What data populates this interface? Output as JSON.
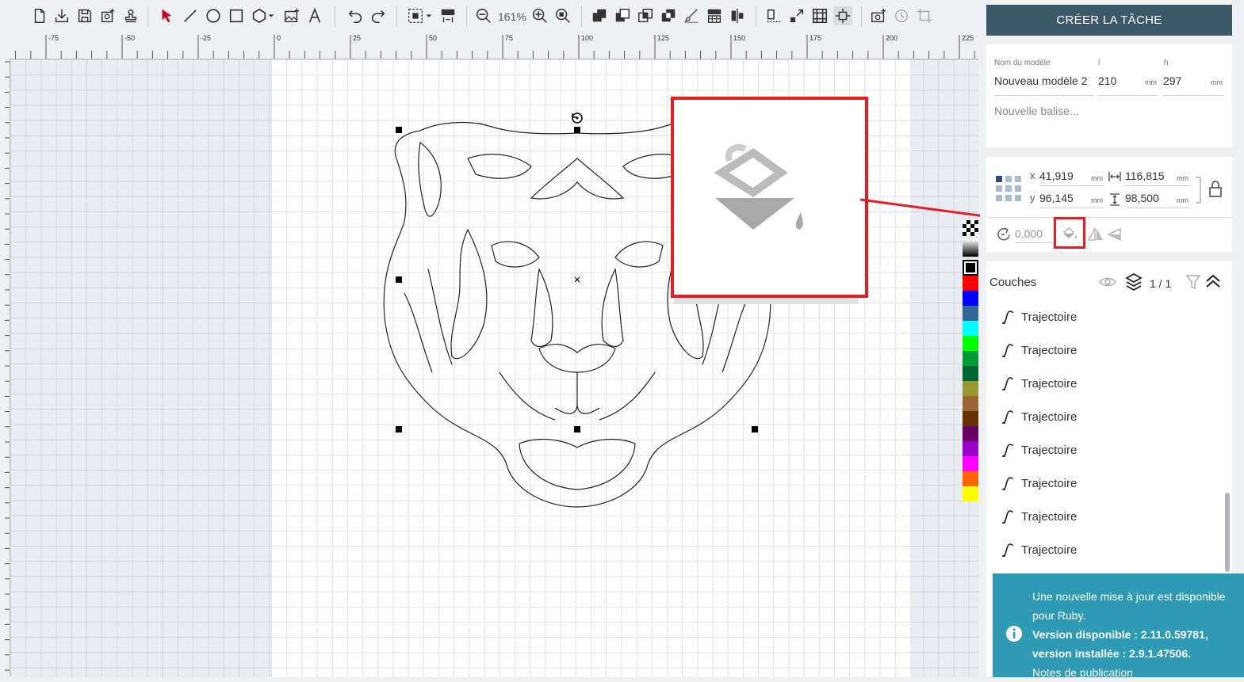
{
  "toolbar": {
    "icons": [
      "new-file-icon",
      "import-icon",
      "save-icon",
      "add-image-icon",
      "stamp-icon",
      "select-arrow-icon",
      "line-icon",
      "circle-icon",
      "rectangle-icon",
      "polygon-icon",
      "image-icon",
      "text-icon",
      "undo-icon",
      "redo-icon",
      "align-icon",
      "beta-icon",
      "zoom-out-icon",
      "zoom-in-icon",
      "zoom-fit-icon",
      "union-icon",
      "subtract-icon",
      "intersect-icon",
      "exclude-icon",
      "brush-icon",
      "beta-grid-icon",
      "align-center-icon",
      "distribute-icon",
      "expand-icon",
      "grid-icon",
      "fit-page-icon",
      "camera-icon",
      "history-icon",
      "crop-icon"
    ],
    "zoom_level": "161%"
  },
  "ruler": {
    "top_labels": [
      "-75",
      "-50",
      "-25",
      "0",
      "25",
      "50",
      "75",
      "100",
      "125",
      "150",
      "175",
      "200",
      "225"
    ]
  },
  "right_panel": {
    "create_task_label": "CRÉER LA TÂCHE",
    "model": {
      "name_label": "Nom du modèle",
      "name_value": "Nouveau modèle 2",
      "width_label": "l",
      "width_value": "210",
      "width_unit": "mm",
      "height_label": "h",
      "height_value": "297",
      "height_unit": "mm",
      "tag_placeholder": "Nouvelle balise..."
    },
    "transform": {
      "x_label": "x",
      "x_value": "41,919",
      "x_unit": "mm",
      "y_label": "y",
      "y_value": "96,145",
      "y_unit": "mm",
      "w_value": "116,815",
      "w_unit": "mm",
      "h_value": "98,500",
      "h_unit": "mm",
      "rotation_value": "0,000"
    },
    "layers": {
      "title": "Couches",
      "count": "1 / 1",
      "items": [
        "Trajectoire",
        "Trajectoire",
        "Trajectoire",
        "Trajectoire",
        "Trajectoire",
        "Trajectoire",
        "Trajectoire",
        "Trajectoire"
      ]
    }
  },
  "palette": [
    "#ff0000",
    "#0000ff",
    "#336699",
    "#00ffff",
    "#00ff00",
    "#009933",
    "#006633",
    "#999933",
    "#996633",
    "#663300",
    "#660066",
    "#9900cc",
    "#ff00ff",
    "#ff6600",
    "#ffff00"
  ],
  "notification": {
    "line1": "Une nouvelle mise à jour est disponible pour Ruby.",
    "line2": "Version disponible : 2.11.0.59781, version installée : 2.9.1.47506.",
    "line3": "Notes de publication"
  }
}
